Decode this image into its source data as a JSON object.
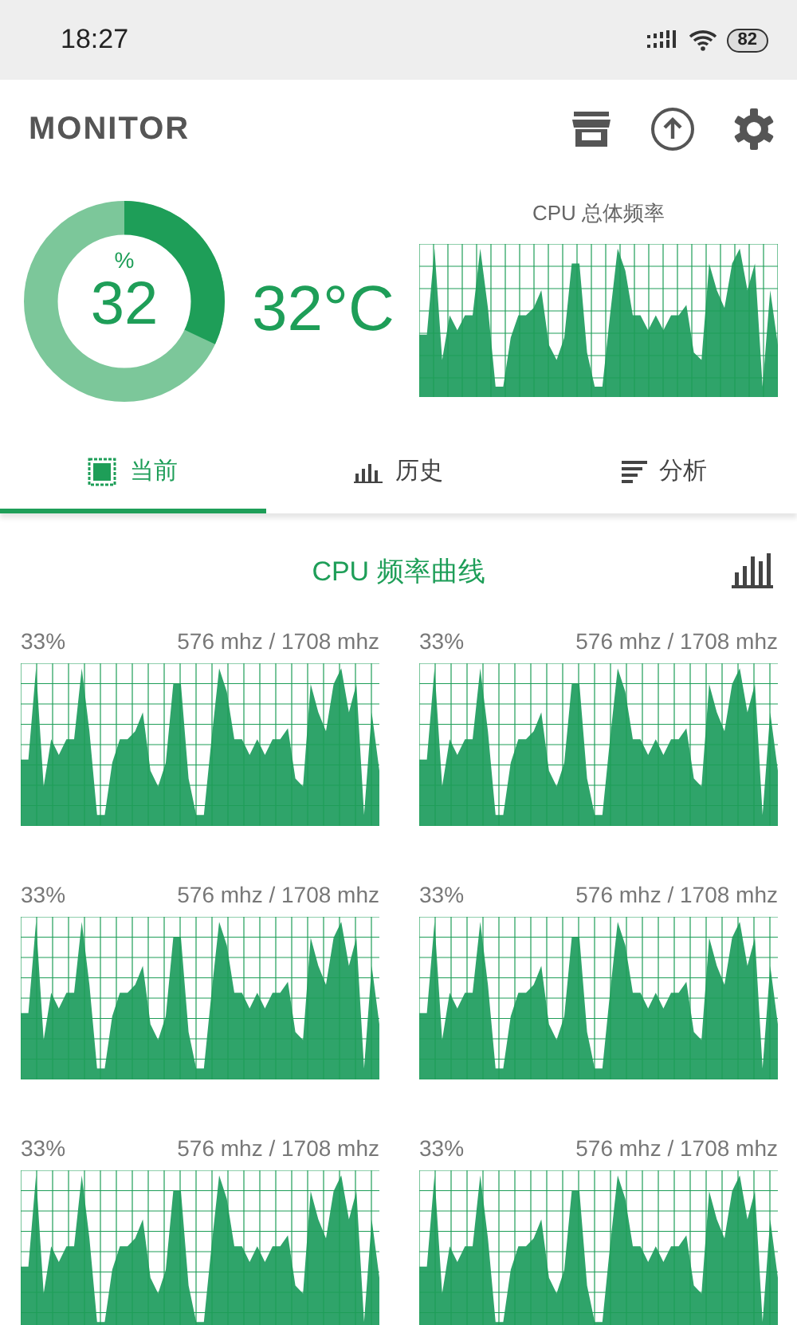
{
  "status_bar": {
    "time": "18:27",
    "battery": "82"
  },
  "header": {
    "title": "MONITOR"
  },
  "overview": {
    "usage_unit": "%",
    "usage": "32",
    "level": 0.32,
    "temperature": "32°C",
    "chart_title": "CPU 总体频率"
  },
  "tabs": [
    {
      "label": "当前",
      "kind": "cpu",
      "selected": true
    },
    {
      "label": "历史",
      "kind": "bars",
      "selected": false
    },
    {
      "label": "分析",
      "kind": "lines",
      "selected": false
    }
  ],
  "section": {
    "title": "CPU 频率曲线"
  },
  "cores": [
    {
      "usage": "33%",
      "frequency": "576 mhz / 1708 mhz"
    },
    {
      "usage": "33%",
      "frequency": "576 mhz / 1708 mhz"
    },
    {
      "usage": "33%",
      "frequency": "576 mhz / 1708 mhz"
    },
    {
      "usage": "33%",
      "frequency": "576 mhz / 1708 mhz"
    },
    {
      "usage": "33%",
      "frequency": "576 mhz / 1708 mhz"
    },
    {
      "usage": "33%",
      "frequency": "576 mhz / 1708 mhz"
    }
  ]
}
